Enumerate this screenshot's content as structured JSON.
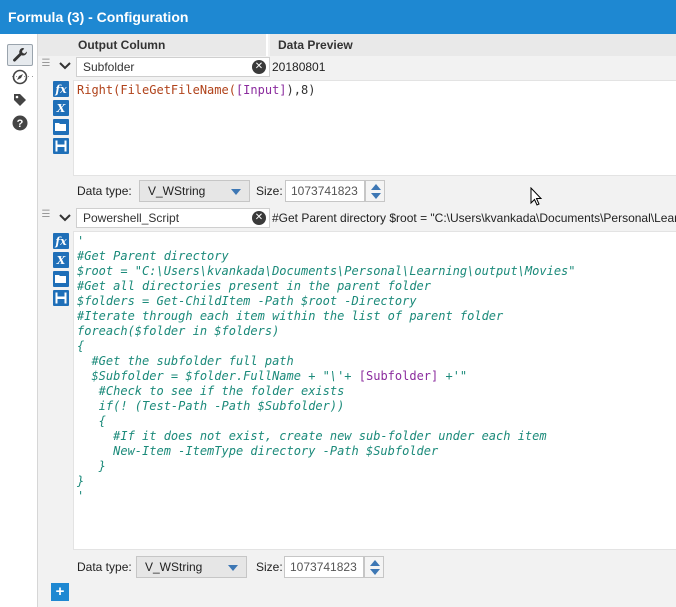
{
  "window": {
    "title": "Formula (3) - Configuration"
  },
  "rail": {
    "icons": [
      "wrench-icon",
      "compass-icon",
      "tag-icon",
      "help-icon"
    ]
  },
  "table": {
    "headers": {
      "output_column": "Output Column",
      "data_preview": "Data Preview"
    }
  },
  "rows": [
    {
      "output_column": "Subfolder",
      "preview": "20180801",
      "expression": {
        "fn1": "Right(",
        "fn2": "FileGetFileName(",
        "field": "[Input]",
        "tail": "),8)"
      },
      "data_type_label": "Data type:",
      "data_type": "V_WString",
      "size_label": "Size:",
      "size": "1073741823"
    },
    {
      "output_column": "Powershell_Script",
      "preview": "#Get Parent directory $root = \"C:\\Users\\kvankada\\Documents\\Personal\\Lear",
      "lines": {
        "l01": "'",
        "l02": "#Get Parent directory",
        "l03": "$root = \"C:\\Users\\kvankada\\Documents\\Personal\\Learning\\output\\Movies\"",
        "l04": "",
        "l05": "#Get all directories present in the parent folder",
        "l06": "$folders = Get-ChildItem -Path $root -Directory",
        "l07": "",
        "l08": "#Iterate through each item within the list of parent folder",
        "l09": "foreach($folder in $folders)",
        "l10": "{",
        "l11": "  #Get the subfolder full path",
        "l12a": "  $Subfolder = $folder.FullName + \"\\'+ ",
        "l12b": "[Subfolder]",
        "l12c": " +'\"",
        "l13": "",
        "l14": "   #Check to see if the folder exists",
        "l15": "   if(! (Test-Path -Path $Subfolder))",
        "l16": "   {",
        "l17": "     #If it does not exist, create new sub-folder under each item",
        "l18": "     New-Item -ItemType directory -Path $Subfolder",
        "l19": "   }",
        "l20": "}",
        "l21": "'"
      },
      "data_type_label": "Data type:",
      "data_type": "V_WString",
      "size_label": "Size:",
      "size": "1073741823"
    }
  ],
  "tools": {
    "fx": "fx",
    "x": "X"
  },
  "add_button": "+",
  "colors": {
    "title_bar": "#1e88d2",
    "function": "#b0421a",
    "field": "#8b2c9e",
    "script": "#1b8a7a"
  }
}
